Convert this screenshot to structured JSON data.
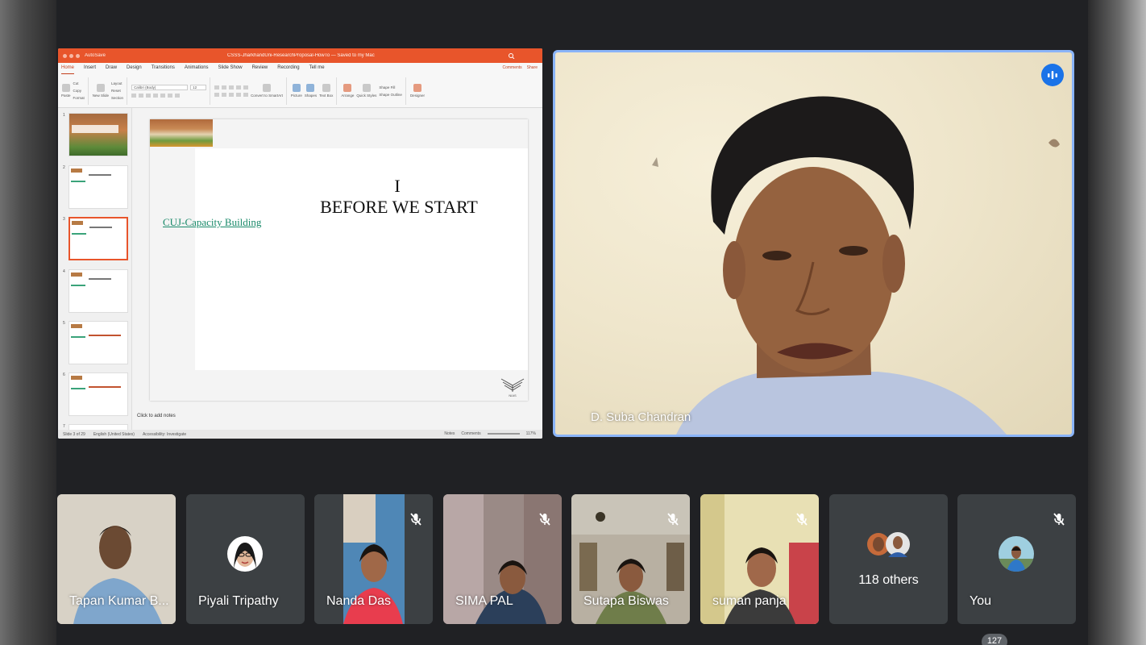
{
  "presentation": {
    "titlebar": {
      "autosave": "AutoSave",
      "filename": "CSSS-JharkhandUni-ResearchProposal-HowTo — Saved to my Mac"
    },
    "ribbon_tabs": [
      "Home",
      "Insert",
      "Draw",
      "Design",
      "Transitions",
      "Animations",
      "Slide Show",
      "Review",
      "Recording",
      "Tell me"
    ],
    "active_tab": "Home",
    "comments_label": "Comments",
    "share_label": "Share",
    "ribbon": {
      "paste": "Paste",
      "cut": "Cut",
      "copy": "Copy",
      "format": "Format",
      "new_slide": "New Slide",
      "layout": "Layout",
      "reset": "Reset",
      "section": "Section",
      "font_name": "Calibri (Body)",
      "font_size": "12",
      "convert_smartart": "Convert to SmartArt",
      "picture": "Picture",
      "shapes": "Shapes",
      "text_box": "Text Box",
      "arrange": "Arrange",
      "quick_styles": "Quick Styles",
      "shape_fill": "Shape Fill",
      "shape_outline": "Shape Outline",
      "designer": "Designer"
    },
    "thumbnails": [
      "1",
      "2",
      "3",
      "4",
      "5",
      "6",
      "7"
    ],
    "selected_thumbnail": "3",
    "slide": {
      "roman": "I",
      "heading": "BEFORE WE START",
      "link": "CUJ-Capacity Building",
      "logo_text": "NIAS"
    },
    "notes_placeholder": "Click to add notes",
    "statusbar": {
      "slide_position": "Slide 3 of 29",
      "language": "English (United States)",
      "accessibility": "Accessibility: Investigate",
      "notes": "Notes",
      "comments": "Comments",
      "zoom": "117%"
    }
  },
  "main_speaker": {
    "name": "D. Suba Chandran"
  },
  "participants": [
    {
      "name": "Tapan Kumar B...",
      "muted": false
    },
    {
      "name": "Piyali Tripathy",
      "muted": false
    },
    {
      "name": "Nanda Das",
      "muted": true
    },
    {
      "name": "SIMA PAL",
      "muted": true
    },
    {
      "name": "Sutapa Biswas",
      "muted": true
    },
    {
      "name": "suman panja",
      "muted": true
    },
    {
      "name": "118 others",
      "muted": false
    },
    {
      "name": "You",
      "muted": true
    }
  ],
  "participant_count": "127",
  "colors": {
    "meet_background": "#202124",
    "tile_background": "#3c4043",
    "active_speaker_border": "#8ab4f8",
    "speaking_badge": "#1a73e8",
    "powerpoint_accent": "#e8552b"
  }
}
